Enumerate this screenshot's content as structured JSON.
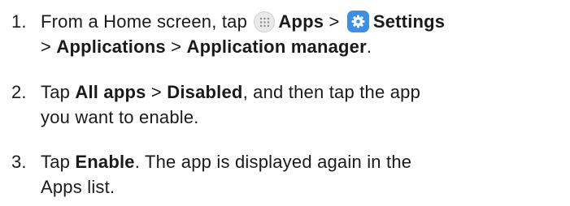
{
  "steps": [
    {
      "number": "1.",
      "text_1": "From a Home screen, tap",
      "apps_icon": "apps-grid-icon",
      "apps": "Apps",
      "sep_1": ">",
      "settings_icon": "gear-icon",
      "settings": "Settings",
      "sep_2": ">",
      "applications": "Applications",
      "sep_3": ">",
      "application_manager": "Application manager",
      "end": "."
    },
    {
      "number": "2.",
      "text_1": "Tap",
      "all_apps": "All apps",
      "sep_1": ">",
      "disabled": "Disabled",
      "text_2": ", and then tap the app",
      "text_3": "you want to enable."
    },
    {
      "number": "3.",
      "text_1": "Tap",
      "enable": "Enable",
      "text_2": ". The app is displayed again in the",
      "text_3": "Apps list."
    }
  ],
  "colors": {
    "text": "#1a1a1a",
    "settings_icon_bg": "#3d8fe6",
    "apps_icon_bg": "#e9e9ea"
  }
}
